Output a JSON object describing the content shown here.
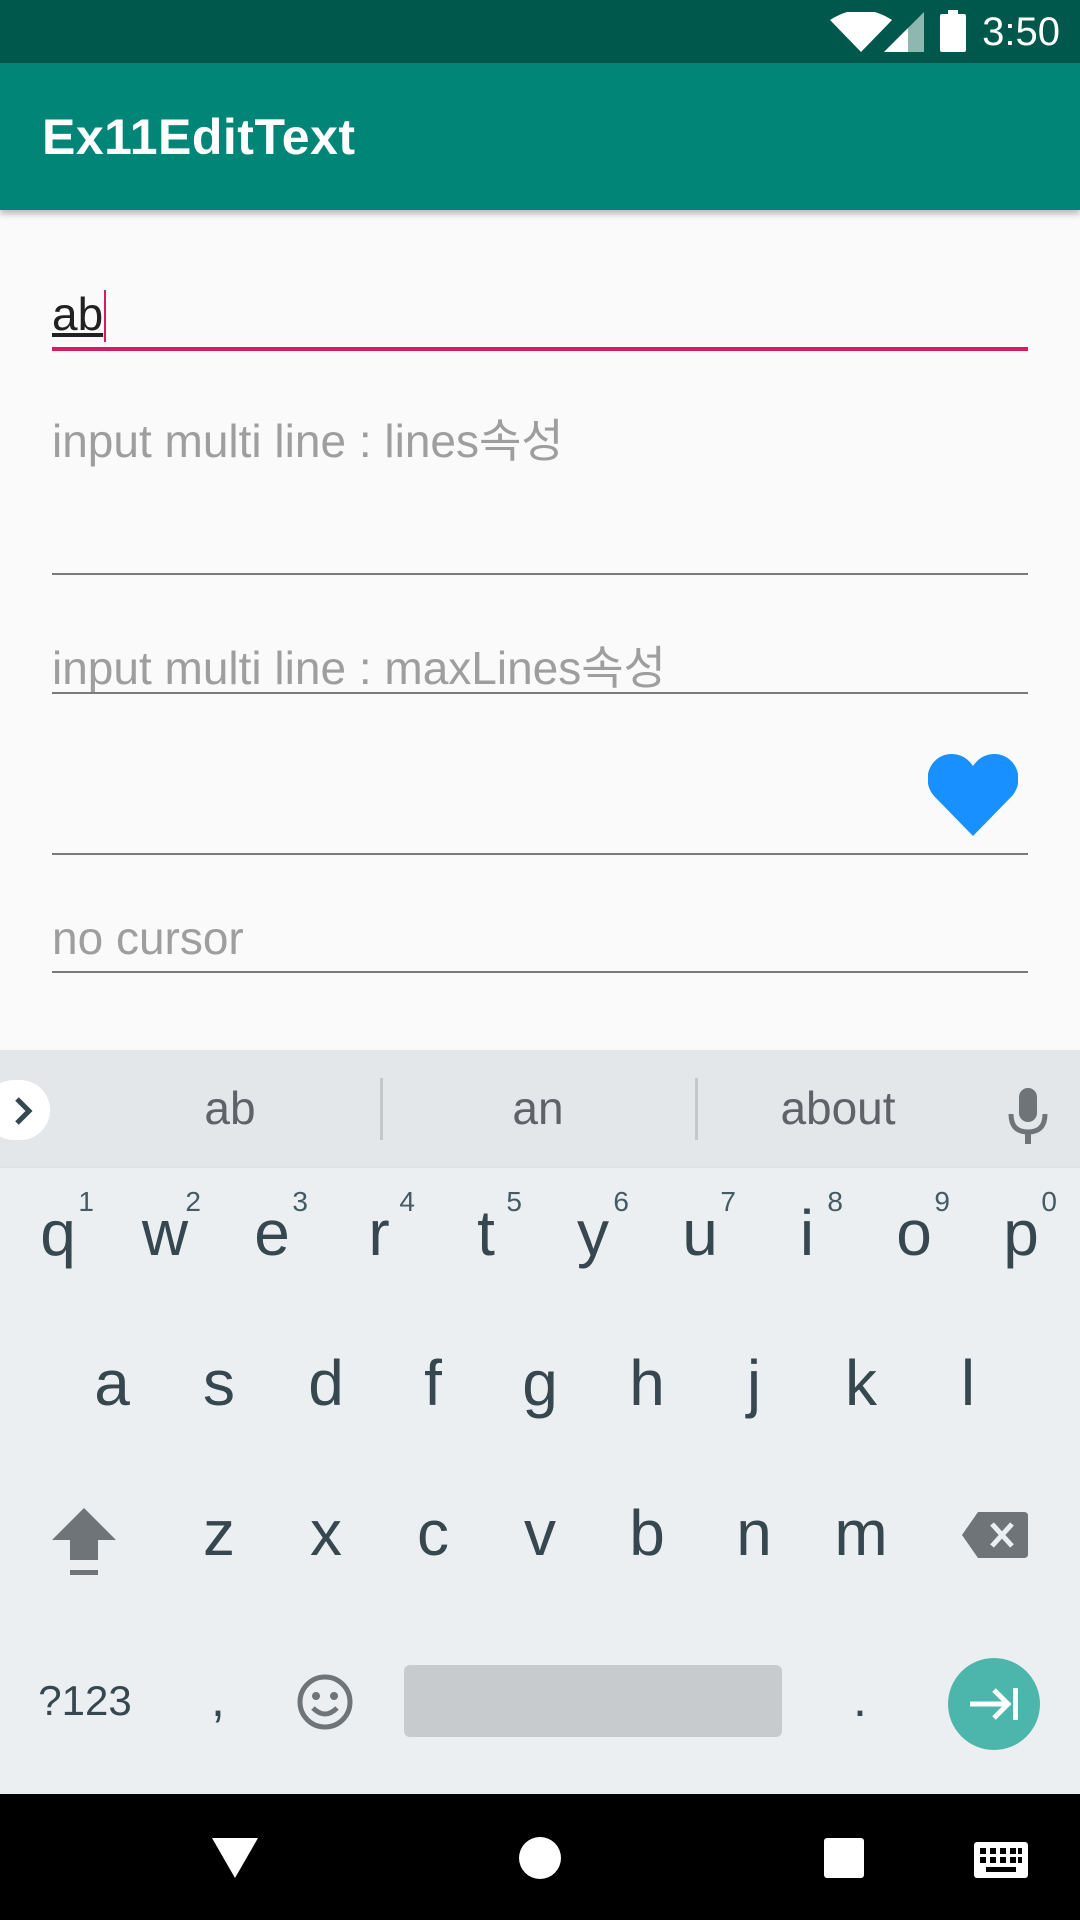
{
  "status_bar": {
    "time": "3:50",
    "icons": [
      "wifi-icon",
      "cell-signal-icon",
      "battery-icon"
    ]
  },
  "app_bar": {
    "title": "Ex11EditText"
  },
  "fields": {
    "input1_value": "ab",
    "lines_hint": "input multi line : lines속성",
    "maxlines_hint": "input multi line : maxLines속성",
    "no_cursor_hint": "no cursor"
  },
  "keyboard": {
    "suggestions": [
      "ab",
      "an",
      "about"
    ],
    "row1": [
      "q",
      "w",
      "e",
      "r",
      "t",
      "y",
      "u",
      "i",
      "o",
      "p"
    ],
    "row1_hints": [
      "1",
      "2",
      "3",
      "4",
      "5",
      "6",
      "7",
      "8",
      "9",
      "0"
    ],
    "row2": [
      "a",
      "s",
      "d",
      "f",
      "g",
      "h",
      "j",
      "k",
      "l"
    ],
    "row3": [
      "z",
      "x",
      "c",
      "v",
      "b",
      "n",
      "m"
    ],
    "symbols_label": "?123",
    "comma": ",",
    "period": "."
  },
  "colors": {
    "status_bar": "#00574b",
    "app_bar": "#008577",
    "focused_underline": "#d81b60",
    "heart": "#1990ff",
    "enter_key": "#4db6ac"
  }
}
